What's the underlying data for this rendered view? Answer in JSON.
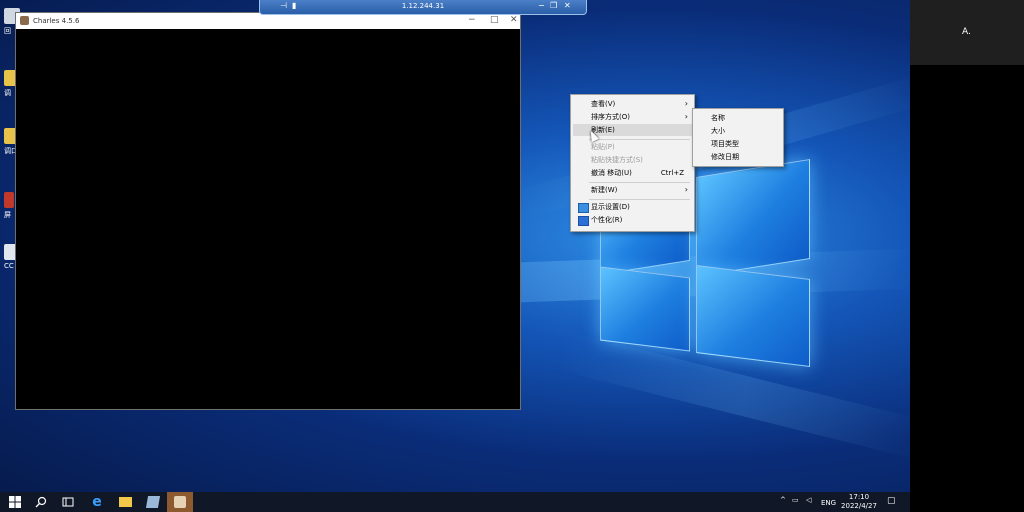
{
  "remote": {
    "address": "1.12.244.31"
  },
  "desktop_icons": [
    {
      "name": "recycle-bin",
      "label": "回"
    },
    {
      "name": "app-1",
      "label": "调"
    },
    {
      "name": "app-2",
      "label": "调口"
    },
    {
      "name": "app-3",
      "label": "屏"
    },
    {
      "name": "app-4",
      "label": "CC"
    }
  ],
  "charles": {
    "title": "Charles 4.5.6"
  },
  "context_menu": {
    "items": [
      {
        "label": "查看(V)",
        "arrow": "›"
      },
      {
        "label": "排序方式(O)",
        "arrow": "›"
      },
      {
        "label": "刷新(E)"
      },
      {
        "label": "粘贴(P)"
      },
      {
        "label": "粘贴快捷方式(S)"
      },
      {
        "label": "撤消 移动(U)",
        "shortcut": "Ctrl+Z"
      },
      {
        "label": "新建(W)",
        "arrow": "›"
      },
      {
        "label": "显示设置(D)"
      },
      {
        "label": "个性化(R)"
      }
    ]
  },
  "submenu": {
    "items": [
      "名称",
      "大小",
      "项目类型",
      "修改日期"
    ]
  },
  "taskbar": {
    "lang": "ENG",
    "time": "17:10",
    "date": "2022/4/27"
  },
  "participant": {
    "name": "A."
  },
  "colors": {
    "taskbar": "#101827",
    "accent": "#1e7fe0"
  }
}
